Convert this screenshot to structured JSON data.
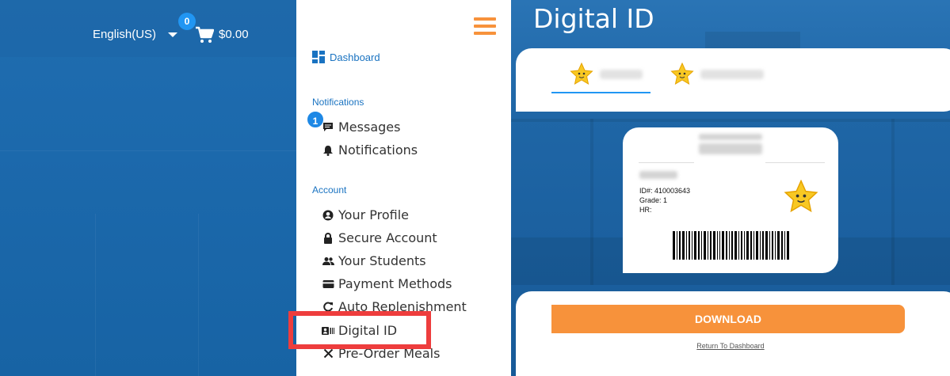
{
  "header": {
    "language": "English(US)",
    "cart_count": "0",
    "cart_total": "$0.00"
  },
  "menu": {
    "dashboard": "Dashboard",
    "sections": {
      "notifications": {
        "title": "Notifications",
        "items": [
          {
            "label": "Messages",
            "icon": "message-icon",
            "badge": "1"
          },
          {
            "label": "Notifications",
            "icon": "bell-icon"
          }
        ]
      },
      "account": {
        "title": "Account",
        "items": [
          {
            "label": "Your Profile",
            "icon": "user-circle-icon"
          },
          {
            "label": "Secure Account",
            "icon": "lock-icon"
          },
          {
            "label": "Your Students",
            "icon": "users-icon"
          },
          {
            "label": "Payment Methods",
            "icon": "credit-card-icon"
          },
          {
            "label": "Auto Replenishment",
            "icon": "refresh-icon"
          },
          {
            "label": "Digital ID",
            "icon": "id-card-icon"
          },
          {
            "label": "Pre-Order Meals",
            "icon": "utensils-icon"
          }
        ]
      }
    }
  },
  "digital_id": {
    "title": "Digital ID",
    "card": {
      "id_line": "ID#: 410003643",
      "grade_line": "Grade: 1",
      "hr_line": "HR:"
    },
    "download_label": "DOWNLOAD",
    "return_label": "Return To Dashboard"
  },
  "colors": {
    "brand_blue": "#1a73c1",
    "accent_orange": "#f7923b",
    "highlight_red": "#ee3d3d"
  }
}
